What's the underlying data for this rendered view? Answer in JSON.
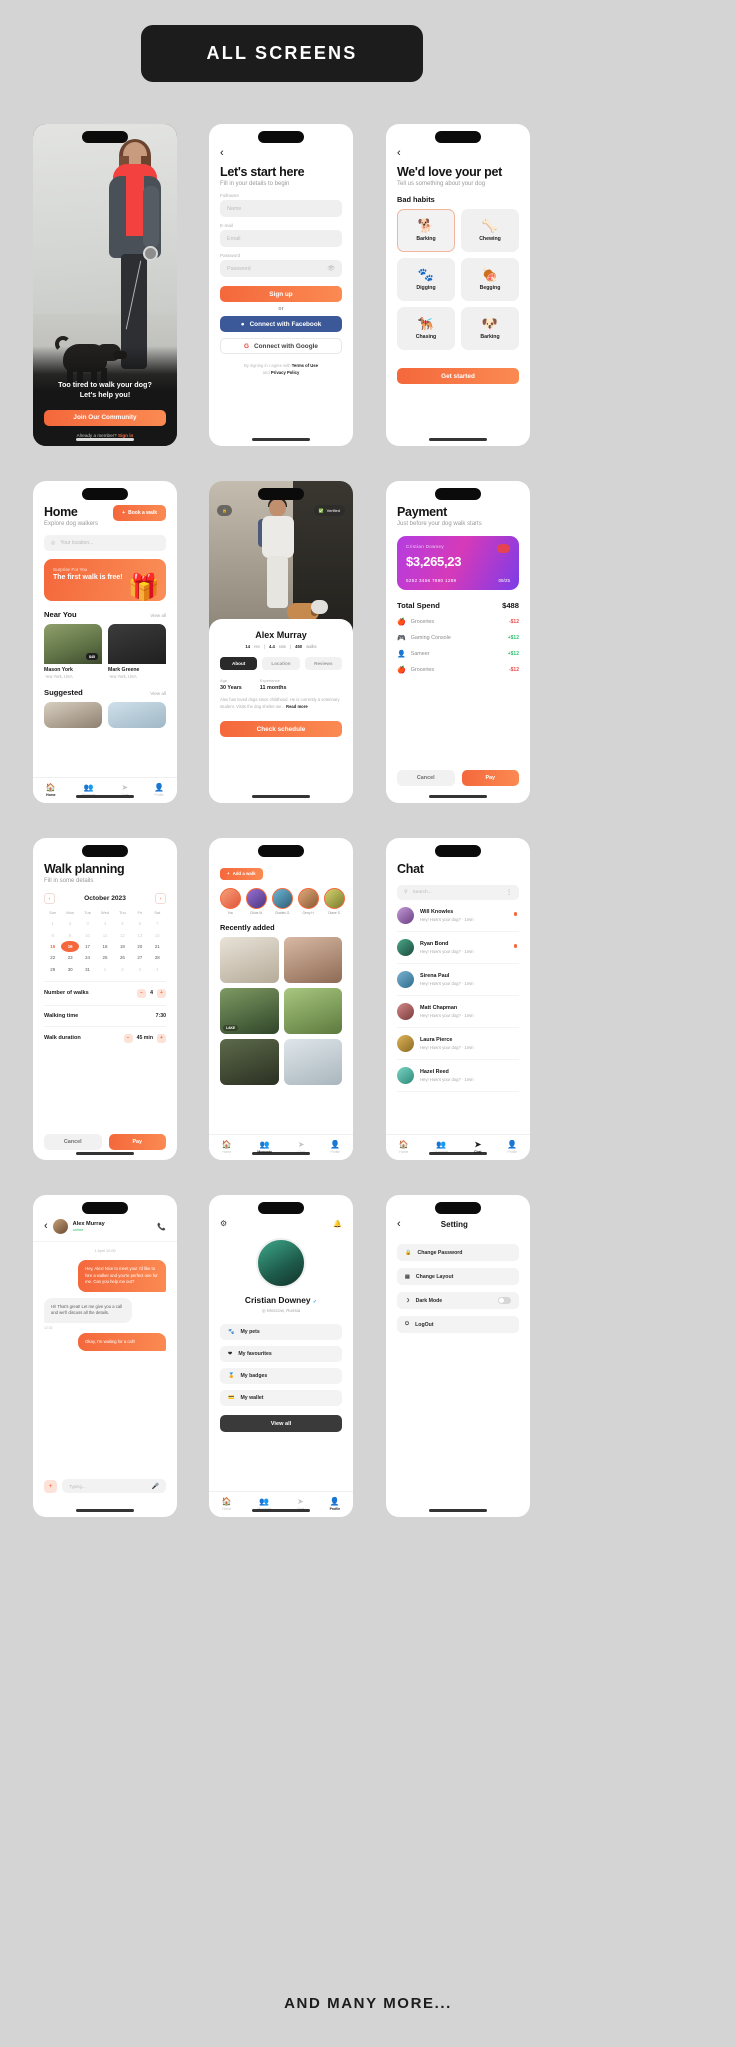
{
  "header": {
    "title": "ALL SCREENS"
  },
  "footer": {
    "note": "AND MANY MORE..."
  },
  "screens": {
    "onboarding": {
      "headline_l1": "Too tired to walk your dog?",
      "headline_l2": "Let's help you!",
      "cta": "Join Our Community",
      "member_text": "Already a member?",
      "signin": "Sign in"
    },
    "signup": {
      "back": "‹",
      "title": "Let's start here",
      "subtitle": "Fill in your details to begin",
      "fields": [
        {
          "label": "Fullname",
          "placeholder": "Name"
        },
        {
          "label": "E-mail",
          "placeholder": "Email"
        },
        {
          "label": "Password",
          "placeholder": "Password"
        }
      ],
      "primary": "Sign up",
      "or": "or",
      "facebook": "Connect with Facebook",
      "google": "Connect with Google",
      "legal_1": "By signing in I agree with",
      "legal_terms": "Terms of Use",
      "legal_2": "and",
      "legal_privacy": "Privacy Policy"
    },
    "pet": {
      "back": "‹",
      "title": "We'd love your pet",
      "subtitle": "Tell us something about your dog",
      "section": "Bad habits",
      "habits": [
        {
          "icon": "🐕",
          "label": "Barking",
          "selected": true
        },
        {
          "icon": "🦴",
          "label": "Chewing",
          "selected": false
        },
        {
          "icon": "🐾",
          "label": "Digging",
          "selected": false
        },
        {
          "icon": "🍖",
          "label": "Begging",
          "selected": false
        },
        {
          "icon": "🐕‍🦺",
          "label": "Chasing",
          "selected": false
        },
        {
          "icon": "🐶",
          "label": "Barking",
          "selected": false
        }
      ],
      "cta": "Get started"
    },
    "home": {
      "title": "Home",
      "subtitle": "Explore dog walkers",
      "book_button": "Book a walk",
      "search_placeholder": "Your location...",
      "promo_small": "Surprise For You",
      "promo_big": "The first walk is free!",
      "promo_emoji": "🎁",
      "near_you": "Near You",
      "view_all": "View all",
      "suggested": "Suggested",
      "walkers": [
        {
          "name": "Mason York",
          "location": "New York, USA",
          "badge": "$45"
        },
        {
          "name": "Mark Greene",
          "location": "New York, USA",
          "badge": ""
        }
      ],
      "tabs": [
        {
          "icon": "🏠",
          "label": "Home",
          "active": true
        },
        {
          "icon": "👥",
          "label": "Moments",
          "active": false
        },
        {
          "icon": "➤",
          "label": "Chat",
          "active": false
        },
        {
          "icon": "👤",
          "label": "Profile",
          "active": false
        }
      ]
    },
    "walker_profile": {
      "chip_left": "🔒",
      "chip_right": "Verified",
      "name": "Alex Murray",
      "stat_reviews": "14",
      "stat_reviews_label": "rev",
      "stat_rating": "4.4",
      "stat_rating_label": "rate",
      "stat_walks": "450",
      "stat_walks_label": "walks",
      "segments": [
        {
          "label": "About",
          "active": true
        },
        {
          "label": "Location",
          "active": false
        },
        {
          "label": "Reviews",
          "active": false
        }
      ],
      "age_label": "Age",
      "age_value": "30 Years",
      "exp_label": "Experience",
      "exp_value": "11 months",
      "bio": "Alex has loved dogs since childhood. He is currently a veterinary student. Visits the dog shelter we...",
      "read_more": "Read more",
      "cta": "Check schedule"
    },
    "payment": {
      "title": "Payment",
      "subtitle": "Just before your dog walk starts",
      "card_name": "Cristian Downey",
      "amount": "$3,265,23",
      "card_number": "5282 3456 7890 1289",
      "card_expiry": "09/25",
      "total_label": "Total Spend",
      "total_value": "$488",
      "transactions": [
        {
          "icon": "🍎",
          "name": "Groceries",
          "amount": "-$12",
          "sign": "neg"
        },
        {
          "icon": "🎮",
          "name": "Gaming Console",
          "amount": "+$12",
          "sign": "pos"
        },
        {
          "icon": "👤",
          "name": "Sameer",
          "amount": "+$12",
          "sign": "pos"
        },
        {
          "icon": "🍎",
          "name": "Groceries",
          "amount": "-$12",
          "sign": "neg"
        }
      ],
      "cancel": "Cancel",
      "pay": "Pay"
    },
    "walk_planning": {
      "title": "Walk planning",
      "subtitle": "Fill in some details",
      "month": "October 2023",
      "prev": "‹",
      "next": "›",
      "weekdays": [
        "Sun",
        "Mon",
        "Tue",
        "Wed",
        "Thu",
        "Fri",
        "Sat"
      ],
      "weeks": [
        [
          "1",
          "2",
          "3",
          "4",
          "5",
          "6",
          "7"
        ],
        [
          "8",
          "9",
          "10",
          "11",
          "12",
          "13",
          "14"
        ],
        [
          "15",
          "16",
          "17",
          "18",
          "19",
          "20",
          "21"
        ],
        [
          "22",
          "23",
          "24",
          "25",
          "26",
          "27",
          "28"
        ],
        [
          "29",
          "30",
          "31",
          "1",
          "2",
          "3",
          "4"
        ]
      ],
      "selected_day": "16",
      "ring_day": "15",
      "options": [
        {
          "label": "Number of walks",
          "value": "4",
          "stepper": true
        },
        {
          "label": "Walking time",
          "value": "7:30",
          "stepper": false
        },
        {
          "label": "Walk duration",
          "value": "45 min",
          "stepper": true
        }
      ],
      "cancel": "Cancel",
      "pay": "Pay"
    },
    "moments": {
      "add_button": "Add a walk",
      "stories": [
        {
          "name": "You"
        },
        {
          "name": "Chloe M."
        },
        {
          "name": "Charles G."
        },
        {
          "name": "Gerry H."
        },
        {
          "name": "Diane S."
        }
      ],
      "section": "Recently added",
      "cells": [
        {
          "tag": ""
        },
        {
          "tag": ""
        },
        {
          "tag": "LAKE"
        },
        {
          "tag": ""
        },
        {
          "tag": ""
        },
        {
          "tag": ""
        }
      ],
      "tabs": [
        {
          "icon": "🏠",
          "label": "Home",
          "active": false
        },
        {
          "icon": "👥",
          "label": "Moments",
          "active": true
        },
        {
          "icon": "➤",
          "label": "Chat",
          "active": false
        },
        {
          "icon": "👤",
          "label": "Profile",
          "active": false
        }
      ]
    },
    "chat_list": {
      "title": "Chat",
      "search_placeholder": "Search...",
      "conversations": [
        {
          "name": "Will Knowles",
          "message": "Hey! How's your dog? · 1min",
          "unread": true
        },
        {
          "name": "Ryan Bond",
          "message": "Hey! How's your dog? · 1min",
          "unread": true
        },
        {
          "name": "Sirena Paul",
          "message": "Hey! How's your dog? · 1min",
          "unread": false
        },
        {
          "name": "Matt Chapman",
          "message": "Hey! How's your dog? · 1min",
          "unread": false
        },
        {
          "name": "Laura Pierce",
          "message": "Hey! How's your dog? · 1min",
          "unread": false
        },
        {
          "name": "Hazel Reed",
          "message": "Hey! How's your dog? · 1min",
          "unread": false
        }
      ],
      "tabs": [
        {
          "icon": "🏠",
          "label": "Home",
          "active": false
        },
        {
          "icon": "👥",
          "label": "Moments",
          "active": false
        },
        {
          "icon": "➤",
          "label": "Chat",
          "active": true
        },
        {
          "icon": "👤",
          "label": "Profile",
          "active": false
        }
      ]
    },
    "chat_thread": {
      "back": "‹",
      "name": "Alex Murray",
      "status": "online",
      "call_icon": "📞",
      "daystamp": "1 April 12:00",
      "messages": [
        {
          "side": "me",
          "text": "Hey, Alex! Nice to meet you! I'd like to hire a walker and you're perfect one for me. Can you help me out?"
        },
        {
          "side": "you",
          "text": "Hi! That's great! Let me give you a call and we'll discuss all the details."
        },
        {
          "side": "time",
          "text": "12:30"
        },
        {
          "side": "me",
          "text": "Okay, I'm waiting for a call!"
        }
      ],
      "composer_placeholder": "Typing...",
      "plus": "+",
      "mic": "🎤"
    },
    "profile": {
      "gear_icon": "⚙",
      "bell_icon": "🔔",
      "name": "Cristian Downey",
      "verified": "✓",
      "location": "Moscow, Russia",
      "menu": [
        {
          "icon": "🐾",
          "label": "My pets"
        },
        {
          "icon": "❤",
          "label": "My favourites"
        },
        {
          "icon": "🏅",
          "label": "My badges"
        },
        {
          "icon": "💳",
          "label": "My wallet"
        }
      ],
      "view_all": "View all",
      "tabs": [
        {
          "icon": "🏠",
          "label": "Home",
          "active": false
        },
        {
          "icon": "👥",
          "label": "Moments",
          "active": false
        },
        {
          "icon": "➤",
          "label": "Chat",
          "active": false
        },
        {
          "icon": "👤",
          "label": "Profile",
          "active": true
        }
      ]
    },
    "settings": {
      "back": "‹",
      "title": "Setting",
      "rows": [
        {
          "icon": "🔒",
          "label": "Change Password",
          "toggle": false
        },
        {
          "icon": "▤",
          "label": "Change Layout",
          "toggle": false
        },
        {
          "icon": "☽",
          "label": "Dark Mode",
          "toggle": true
        },
        {
          "icon": "⏻",
          "label": "LogOut",
          "toggle": false
        }
      ]
    }
  },
  "colors": {
    "accent": "#f4683c",
    "dark": "#1d1d1d",
    "bg": "#d4d4d4"
  }
}
